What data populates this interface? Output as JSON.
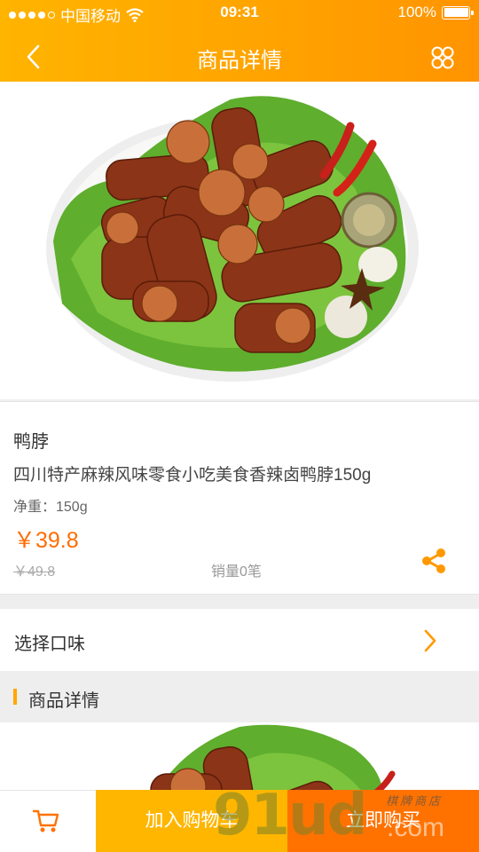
{
  "status_bar": {
    "carrier": "中国移动",
    "time": "09:31",
    "battery": "100%"
  },
  "header": {
    "title": "商品详情",
    "back_icon": "chevron-left-icon",
    "menu_icon": "grid-icon"
  },
  "product": {
    "name": "鸭脖",
    "description": "四川特产麻辣风味零食小吃美食香辣卤鸭脖150g",
    "weight": "净重：150g",
    "price": "￥39.8",
    "original_price": "￥49.8",
    "sales": "销量0笔",
    "share_icon": "share-icon"
  },
  "options": {
    "label": "选择口味"
  },
  "section": {
    "title": "商品详情"
  },
  "bottom_bar": {
    "cart_icon": "cart-icon",
    "add_to_cart": "加入购物车",
    "buy_now": "立即购买"
  },
  "watermark": {
    "text": "91ud",
    "sub": ".com",
    "small": "棋牌商店"
  },
  "colors": {
    "accent": "#ffa200",
    "price": "#ff6d00",
    "add_cart": "#ffb600",
    "buy_now": "#ff7200"
  }
}
